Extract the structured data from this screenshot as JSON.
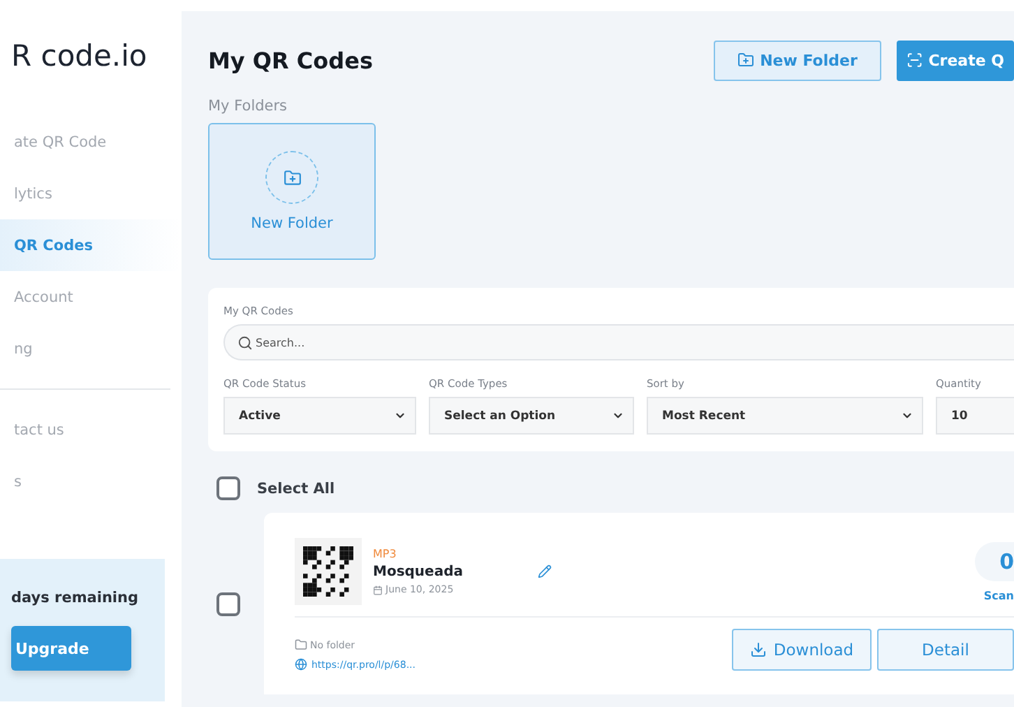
{
  "brand": "R code.io",
  "sidebar": {
    "items": [
      {
        "label": "ate QR Code",
        "selected": false
      },
      {
        "label": "lytics",
        "selected": false
      },
      {
        "label": "QR Codes",
        "selected": true
      },
      {
        "label": "Account",
        "selected": false
      },
      {
        "label": "ng",
        "selected": false
      }
    ],
    "secondary": [
      {
        "label": "tact us"
      },
      {
        "label": "s"
      }
    ],
    "trial": {
      "text": "days remaining",
      "button": "Upgrade"
    }
  },
  "header": {
    "title": "My QR Codes",
    "new_folder": "New Folder",
    "create": "Create Q"
  },
  "folders": {
    "label": "My Folders",
    "new_folder": "New Folder"
  },
  "filters": {
    "title": "My QR Codes",
    "search": {
      "placeholder": "Search..."
    },
    "selects": [
      {
        "label": "QR Code Status",
        "value": "Active",
        "kind": "dropdown"
      },
      {
        "label": "QR Code Types",
        "value": "Select an Option",
        "kind": "dropdown"
      },
      {
        "label": "Sort by",
        "value": "Most Recent",
        "kind": "dropdown"
      },
      {
        "label": "Quantity",
        "value": "10",
        "kind": "number"
      }
    ]
  },
  "select_all": {
    "label": "Select All",
    "checked": false
  },
  "qr_codes": [
    {
      "type": "MP3",
      "name": "Mosqueada",
      "date": "June 10, 2025",
      "checked": false,
      "folder": "No folder",
      "url": "https://qr.pro/l/p/68...",
      "scans": "0",
      "scans_label": "Scan",
      "download": "Download",
      "detail": "Detail"
    }
  ]
}
